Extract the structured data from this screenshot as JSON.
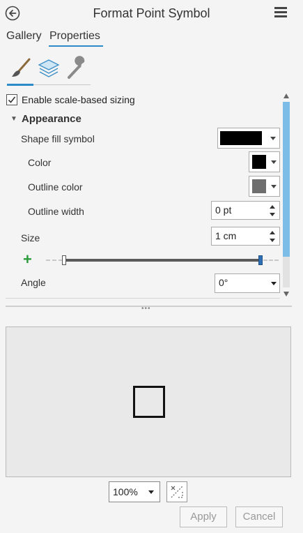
{
  "header": {
    "title": "Format Point Symbol",
    "back_icon": "back-arrow-icon",
    "menu_icon": "hamburger-menu-icon"
  },
  "tabs": {
    "gallery": "Gallery",
    "properties": "Properties",
    "active": "Properties"
  },
  "tools": [
    {
      "name": "symbol-brush-icon",
      "active": true
    },
    {
      "name": "layers-icon",
      "active": false
    },
    {
      "name": "wrench-icon",
      "active": false
    }
  ],
  "properties": {
    "scale_sizing": {
      "label": "Enable scale-based sizing",
      "checked": true
    },
    "section": {
      "title": "Appearance",
      "expanded": true
    },
    "shape_fill": {
      "label": "Shape fill symbol",
      "color": "#000000"
    },
    "color": {
      "label": "Color",
      "value": "#000000"
    },
    "outline_color": {
      "label": "Outline color",
      "value": "#6e6e6e"
    },
    "outline_width": {
      "label": "Outline width",
      "value": "0 pt"
    },
    "size": {
      "label": "Size",
      "value": "1 cm"
    },
    "angle": {
      "label": "Angle",
      "value": "0°"
    }
  },
  "preview": {
    "zoom": "100%"
  },
  "actions": {
    "apply": "Apply",
    "cancel": "Cancel"
  },
  "colors": {
    "accent": "#2e8bc9",
    "scroll_thumb": "#7cbde8",
    "add_green": "#2a9b3a"
  }
}
